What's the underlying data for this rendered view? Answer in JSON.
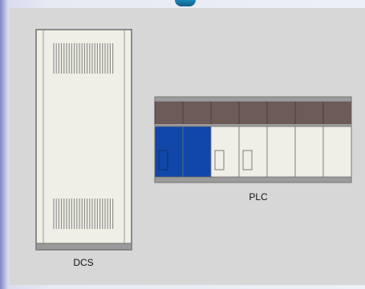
{
  "labels": {
    "dcs": "DCS",
    "plc": "PLC"
  },
  "colors": {
    "canvas": "#d7d7d7",
    "cabinet_body": "#f0efe6",
    "cabinet_outline": "#777777",
    "cabinet_base": "#9a9a9a",
    "rack_top_band": "#6d5b58",
    "rack_rail": "#9c9c9c",
    "module_active": "#1147a8",
    "module_idle": "#efeee7"
  },
  "icons": {
    "dcs": "cabinet-icon",
    "plc": "rack-icon"
  }
}
